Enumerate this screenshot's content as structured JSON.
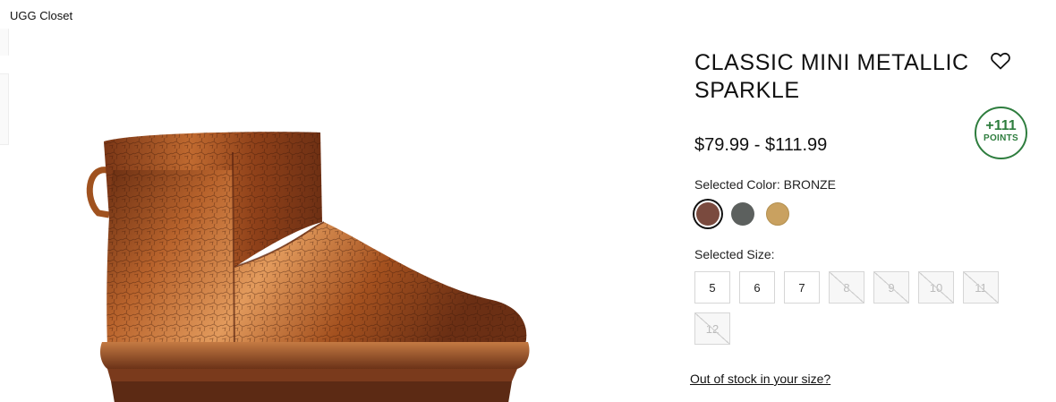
{
  "brand": {
    "label": "UGG Closet"
  },
  "product": {
    "title": "CLASSIC MINI METALLIC SPARKLE",
    "price_range": "$79.99 - $111.99",
    "points": {
      "value": "+111",
      "label": "POINTS"
    },
    "selected_color_label": "Selected Color: BRONZE",
    "colors": [
      {
        "name": "bronze",
        "hex": "#7a4a3e",
        "selected": true
      },
      {
        "name": "grey",
        "hex": "#5c605e",
        "selected": false
      },
      {
        "name": "gold",
        "hex": "#c9a160",
        "selected": false
      }
    ],
    "selected_size_label": "Selected Size:",
    "sizes": [
      {
        "label": "5",
        "available": true
      },
      {
        "label": "6",
        "available": true
      },
      {
        "label": "7",
        "available": true
      },
      {
        "label": "8",
        "available": false
      },
      {
        "label": "9",
        "available": false
      },
      {
        "label": "10",
        "available": false
      },
      {
        "label": "11",
        "available": false
      },
      {
        "label": "12",
        "available": false
      }
    ],
    "out_of_stock_link": "Out of stock in your size?"
  },
  "colors": {
    "points_green": "#2e7d3e",
    "text": "#111111",
    "border": "#d6d6d6"
  }
}
